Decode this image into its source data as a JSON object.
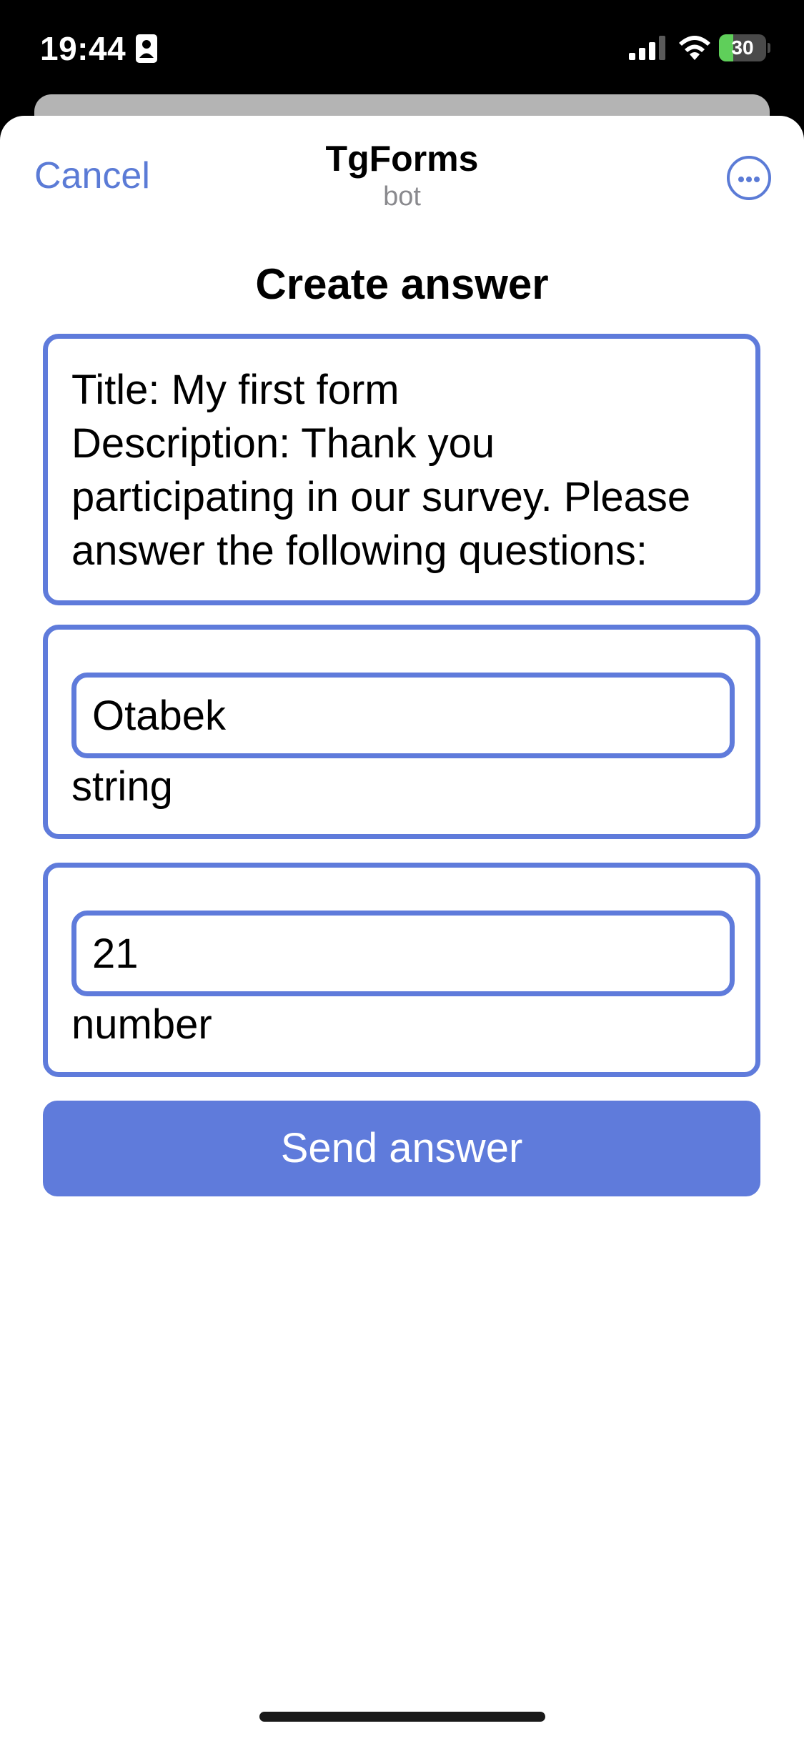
{
  "status_bar": {
    "time": "19:44",
    "battery_level": "30",
    "battery_fraction": 0.3,
    "icons": [
      "id-badge-icon",
      "cellular-signal-icon",
      "wifi-icon",
      "battery-charging-icon"
    ]
  },
  "header": {
    "cancel_label": "Cancel",
    "title": "TgForms",
    "subtitle": "bot",
    "more_icon": "more-options-icon"
  },
  "form": {
    "heading": "Create answer",
    "description_lines": [
      "Title: My first form",
      "Description: Thank you",
      "participating in our survey. Please",
      "answer the following questions:"
    ],
    "questions": [
      {
        "value": "Otabek",
        "type_label": "string"
      },
      {
        "value": "21",
        "type_label": "number"
      }
    ],
    "submit_label": "Send answer"
  },
  "colors": {
    "accent": "#5f7bdb",
    "link": "#5b7bd6",
    "subtitle": "#8a8a8e",
    "battery_fill": "#5fcf5a",
    "status_bar_bg": "#000000",
    "sheet_bg": "#ffffff"
  }
}
